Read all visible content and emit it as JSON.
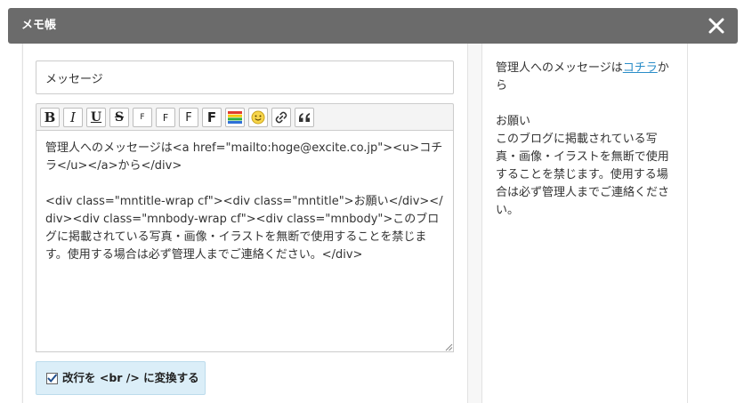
{
  "dialog": {
    "title": "メモ帳",
    "close_icon": "close-icon"
  },
  "form": {
    "subject_value": "メッセージ",
    "editor_text": "管理人へのメッセージは<a href=\"mailto:hoge@excite.co.jp\"><u>コチラ</u></a>から</div>\n\n<div class=\"mntitle-wrap cf\"><div class=\"mntitle\">お願い</div></div><div class=\"mnbody-wrap cf\"><div class=\"mnbody\">このブログに掲載されている写真・画像・イラストを無断で使用することを禁じます。使用する場合は必ず管理人までご連絡ください。</div>",
    "br_option": {
      "label": "改行を <br /> に変換する",
      "checked": true
    }
  },
  "toolbar": {
    "buttons": [
      {
        "name": "bold-button",
        "glyph": "B",
        "icon": "bold-icon"
      },
      {
        "name": "italic-button",
        "glyph": "I",
        "icon": "italic-icon"
      },
      {
        "name": "underline-button",
        "glyph": "U",
        "icon": "underline-icon"
      },
      {
        "name": "strikethrough-button",
        "glyph": "S",
        "icon": "strikethrough-icon"
      },
      {
        "name": "font-size-small-button",
        "glyph": "F",
        "icon": "font-small-icon"
      },
      {
        "name": "font-size-medium-button",
        "glyph": "F",
        "icon": "font-medium-icon"
      },
      {
        "name": "font-size-large-button",
        "glyph": "F",
        "icon": "font-large-icon"
      },
      {
        "name": "font-size-xlarge-button",
        "glyph": "F",
        "icon": "font-xlarge-icon"
      },
      {
        "name": "text-color-button",
        "glyph": "",
        "icon": "color-bars-icon"
      },
      {
        "name": "emoji-button",
        "glyph": "",
        "icon": "smiley-icon"
      },
      {
        "name": "link-button",
        "glyph": "",
        "icon": "link-icon"
      },
      {
        "name": "quote-button",
        "glyph": "",
        "icon": "quote-icon"
      }
    ],
    "colors": {
      "red": "#e23b2e",
      "yellow": "#f5c800",
      "green": "#2fae3c",
      "blue": "#2e6fd8",
      "emoji": "#f7d54a"
    }
  },
  "preview": {
    "line1_before": "管理人へのメッセージは",
    "line1_link": "コチラ",
    "line1_after": "から",
    "heading": "お願い",
    "body": "このブログに掲載されている写真・画像・イラストを無断で使用することを禁じます。使用する場合は必ず管理人までご連絡ください。"
  }
}
